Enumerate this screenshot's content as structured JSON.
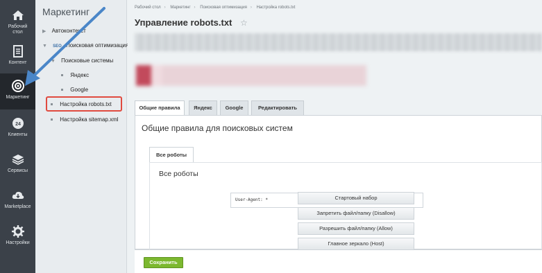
{
  "rail": {
    "items": [
      {
        "label_line1": "Рабочий",
        "label_line2": "стол",
        "icon": "home-icon"
      },
      {
        "label_line1": "Контент",
        "label_line2": "",
        "icon": "document-icon"
      },
      {
        "label_line1": "Маркетинг",
        "label_line2": "",
        "icon": "target-icon"
      },
      {
        "label_line1": "Клиенты",
        "label_line2": "",
        "icon": "clients-icon"
      },
      {
        "label_line1": "Сервисы",
        "label_line2": "",
        "icon": "layers-icon"
      },
      {
        "label_line1": "Marketplace",
        "label_line2": "",
        "icon": "cloud-icon"
      },
      {
        "label_line1": "Настройки",
        "label_line2": "",
        "icon": "gear-icon"
      }
    ],
    "clients_glyph": "24"
  },
  "menu": {
    "title": "Маркетинг",
    "items": [
      {
        "label": "Автоконтекст"
      },
      {
        "label": "Поисковая оптимизация",
        "badge": "SEO"
      },
      {
        "label": "Поисковые системы"
      },
      {
        "label": "Яндекс"
      },
      {
        "label": "Google"
      },
      {
        "label": "Настройка robots.txt"
      },
      {
        "label": "Настройка sitemap.xml"
      }
    ]
  },
  "breadcrumbs": [
    "Рабочий стол",
    "Маркетинг",
    "Поисковая оптимизация",
    "Настройка robots.txt"
  ],
  "page": {
    "title": "Управление robots.txt",
    "star": "☆"
  },
  "tabs": [
    "Общие правила",
    "Яндекс",
    "Google",
    "Редактировать"
  ],
  "panel": {
    "title": "Общие правила для поисковых систем",
    "subtab": "Все роботы",
    "inner_title": "Все роботы",
    "code": "User-Agent: *"
  },
  "side_buttons": [
    "Стартовый набор",
    "Запретить файл/папку (Disallow)",
    "Разрешить файл/папку (Allow)",
    "Главное зеркало (Host)"
  ],
  "footer": {
    "save_label": "Сохранить"
  },
  "colors": {
    "rail_bg": "#3b4149",
    "highlight": "#e04a3f",
    "arrow": "#4a86c8",
    "save": "#7cb82f"
  }
}
